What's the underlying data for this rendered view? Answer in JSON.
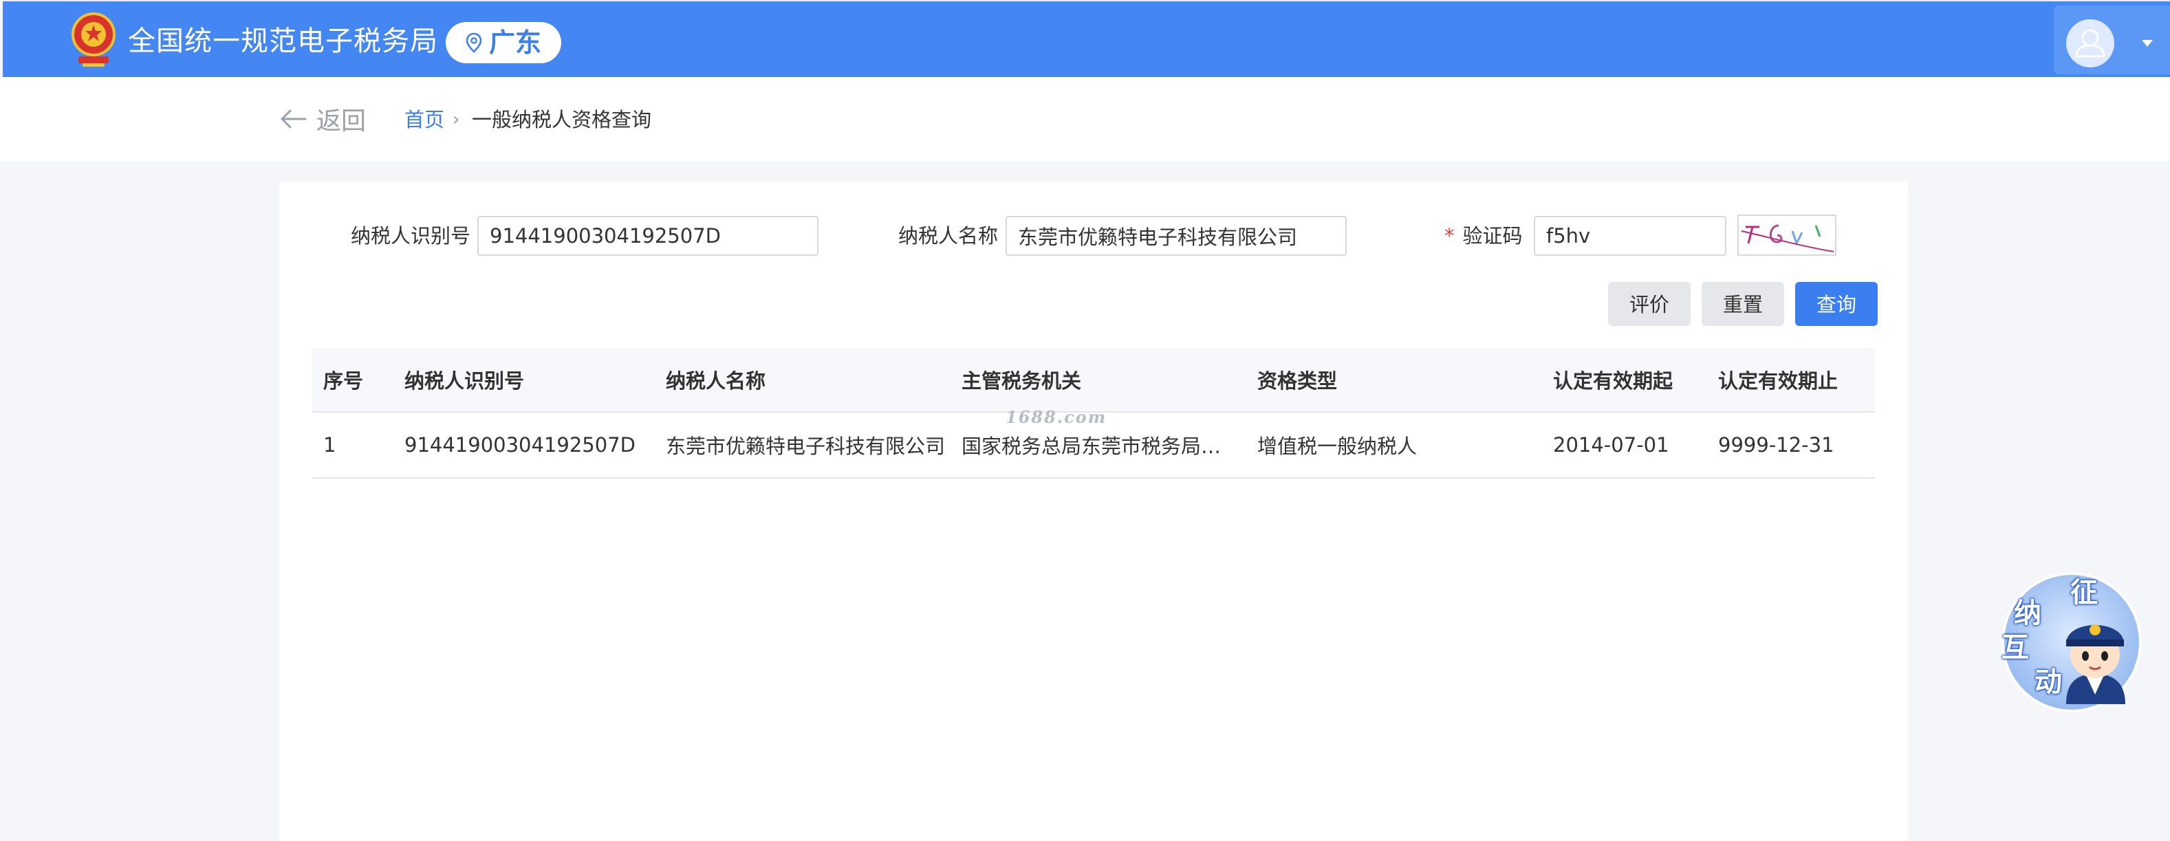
{
  "header": {
    "site_title": "全国统一规范电子税务局",
    "region": "广东",
    "emblem_icon": "national-emblem-icon",
    "user_icon": "user-avatar-icon"
  },
  "breadcrumb": {
    "back_label": "返回",
    "home_label": "首页",
    "separator": "›",
    "current_label": "一般纳税人资格查询"
  },
  "form": {
    "taxpayer_id_label": "纳税人识别号",
    "taxpayer_id_value": "91441900304192507D",
    "taxpayer_name_label": "纳税人名称",
    "taxpayer_name_value": "东莞市优籁特电子科技有限公司",
    "captcha_required_mark": "*",
    "captcha_label": "验证码",
    "captcha_value": "f5hv"
  },
  "buttons": {
    "evaluate_label": "评价",
    "reset_label": "重置",
    "query_label": "查询"
  },
  "table": {
    "columns": [
      "序号",
      "纳税人识别号",
      "纳税人名称",
      "主管税务机关",
      "资格类型",
      "认定有效期起",
      "认定有效期止"
    ],
    "rows": [
      [
        "1",
        "91441900304192507D",
        "东莞市优籁特电子科技有限公司",
        "国家税务总局东莞市税务局清...",
        "增值税一般纳税人",
        "2014-07-01",
        "9999-12-31"
      ]
    ]
  },
  "watermark": "1688.com",
  "assistant": {
    "chars": [
      "征",
      "纳",
      "互",
      "动"
    ],
    "icon": "tax-assistant-mascot-icon"
  },
  "colors": {
    "header_bg": "#4487f2",
    "primary": "#3a7ef0",
    "required": "#e64040"
  }
}
